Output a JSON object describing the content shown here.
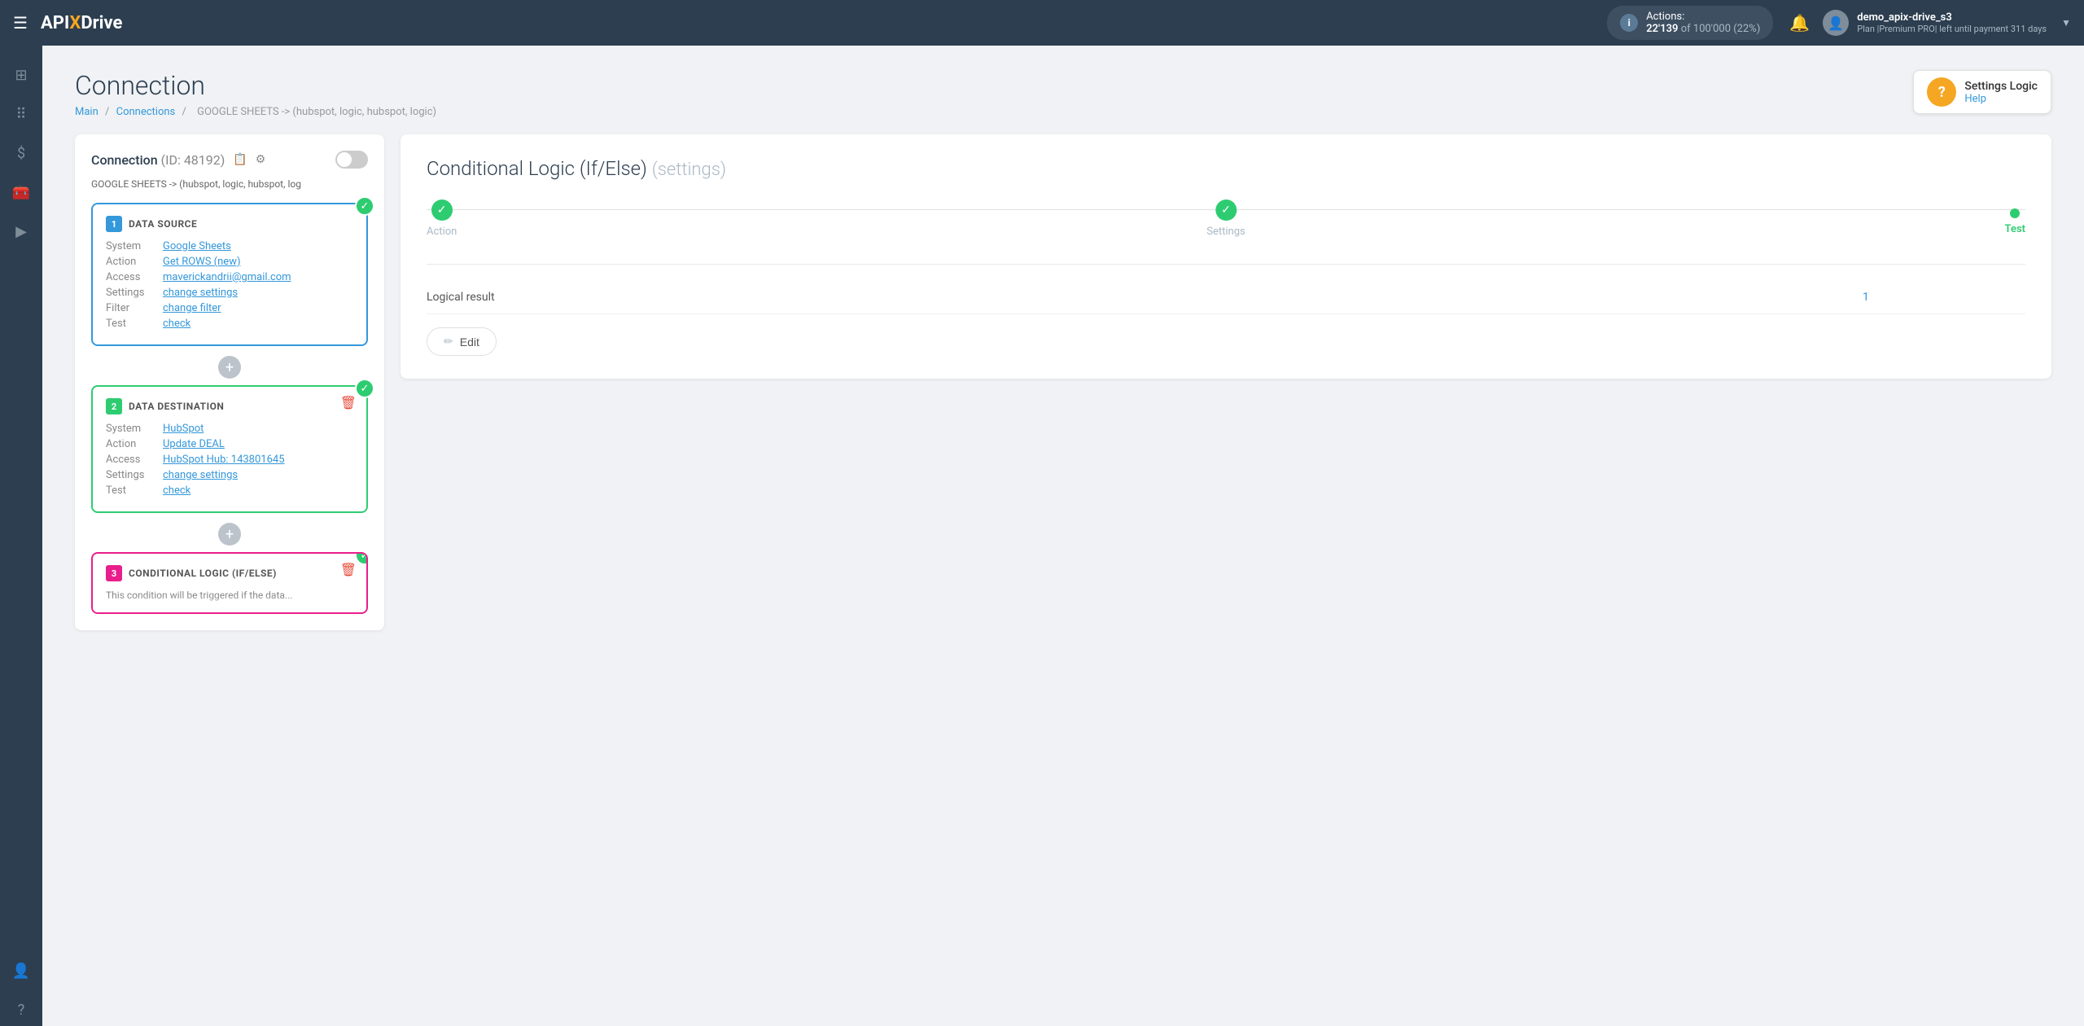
{
  "navbar": {
    "logo": {
      "api": "API",
      "x": "X",
      "drive": "Drive"
    },
    "actions_label": "Actions:",
    "actions_count": "22'139",
    "actions_of": "of",
    "actions_limit": "100'000",
    "actions_pct": "(22%)",
    "username": "demo_apix-drive_s3",
    "plan": "Plan  |Premium PRO|  left until payment",
    "plan_days": "311 days"
  },
  "sidebar": {
    "items": [
      {
        "icon": "⊞",
        "label": "home"
      },
      {
        "icon": "⠿",
        "label": "connections"
      },
      {
        "icon": "$",
        "label": "billing"
      },
      {
        "icon": "🧰",
        "label": "tools"
      },
      {
        "icon": "▶",
        "label": "media"
      },
      {
        "icon": "👤",
        "label": "profile"
      },
      {
        "icon": "?",
        "label": "help"
      }
    ]
  },
  "page": {
    "title": "Connection",
    "breadcrumb": {
      "main": "Main",
      "connections": "Connections",
      "current": "GOOGLE SHEETS -> (hubspot, logic, hubspot, logic)"
    }
  },
  "help": {
    "label": "Settings Logic",
    "link": "Help"
  },
  "connection_panel": {
    "title": "Connection",
    "id_label": "(ID: 48192)",
    "subtitle": "GOOGLE SHEETS -> (hubspot, logic, hubspot, log",
    "cards": [
      {
        "num": "1",
        "type": "DATA SOURCE",
        "color": "blue",
        "status": "done",
        "rows": [
          {
            "label": "System",
            "value": "Google Sheets",
            "link": true
          },
          {
            "label": "Action",
            "value": "Get ROWS (new)",
            "link": true
          },
          {
            "label": "Access",
            "value": "maverickandrii@gmail.com",
            "link": true
          },
          {
            "label": "Settings",
            "value": "change settings",
            "link": true
          },
          {
            "label": "Filter",
            "value": "change filter",
            "link": true
          },
          {
            "label": "Test",
            "value": "check",
            "link": true
          }
        ]
      },
      {
        "num": "2",
        "type": "DATA DESTINATION",
        "color": "green",
        "status": "done",
        "rows": [
          {
            "label": "System",
            "value": "HubSpot",
            "link": true
          },
          {
            "label": "Action",
            "value": "Update DEAL",
            "link": true
          },
          {
            "label": "Access",
            "value": "HubSpot Hub: 143801645",
            "link": true
          },
          {
            "label": "Settings",
            "value": "change settings",
            "link": true
          },
          {
            "label": "Test",
            "value": "check",
            "link": true
          }
        ]
      },
      {
        "num": "3",
        "type": "CONDITIONAL LOGIC (IF/ELSE)",
        "color": "pink",
        "status": "done",
        "preview": "This condition will be triggered if the data..."
      }
    ]
  },
  "right_panel": {
    "title": "Conditional Logic (If/Else)",
    "title_settings": "(settings)",
    "steps": [
      {
        "label": "Action",
        "state": "done"
      },
      {
        "label": "Settings",
        "state": "done"
      },
      {
        "label": "Test",
        "state": "active"
      }
    ],
    "result": {
      "label": "Logical result",
      "value": "1"
    },
    "edit_button": "Edit"
  }
}
